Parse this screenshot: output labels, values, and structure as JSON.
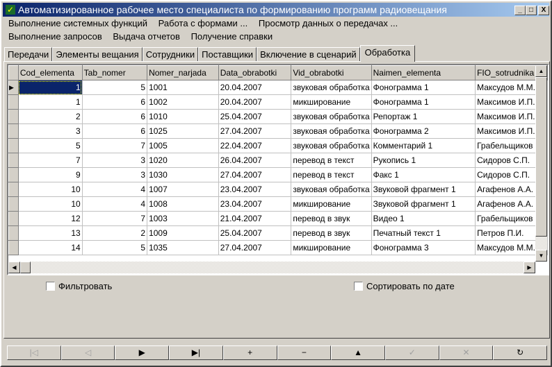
{
  "window": {
    "title": "Автоматизированное рабочее место специалиста по формированию программ радиовещания",
    "min": "_",
    "max": "□",
    "close": "X"
  },
  "menu": {
    "row1": [
      "Выполнение системных функций",
      "Работа с формами ...",
      "Просмотр данных о передачах ..."
    ],
    "row2": [
      "Выполнение запросов",
      "Выдача отчетов",
      "Получение справки"
    ]
  },
  "tabs": [
    "Передачи",
    "Элементы вещания",
    "Сотрудники",
    "Поставщики",
    "Включение в сценарий",
    "Обработка"
  ],
  "active_tab": "Обработка",
  "grid": {
    "columns": [
      "Cod_elementa",
      "Tab_nomer",
      "Nomer_narjada",
      "Data_obrabotki",
      "Vid_obrabotki",
      "Naimen_elementa",
      "FIO_sotrudnika"
    ],
    "rows": [
      [
        "1",
        "5",
        "1001",
        "20.04.2007",
        "звуковая обработка",
        "Фонограмма 1",
        "Максудов М.М."
      ],
      [
        "1",
        "6",
        "1002",
        "20.04.2007",
        "микширование",
        "Фонограмма 1",
        "Максимов И.П."
      ],
      [
        "2",
        "6",
        "1010",
        "25.04.2007",
        "звуковая обработка",
        "Репортаж 1",
        "Максимов И.П."
      ],
      [
        "3",
        "6",
        "1025",
        "27.04.2007",
        "звуковая обработка",
        "Фонограмма 2",
        "Максимов И.П."
      ],
      [
        "5",
        "7",
        "1005",
        "22.04.2007",
        "звуковая обработка",
        "Комментарий 1",
        "Грабельщиков П"
      ],
      [
        "7",
        "3",
        "1020",
        "26.04.2007",
        "перевод в текст",
        "Рукопись 1",
        "Сидоров С.П."
      ],
      [
        "9",
        "3",
        "1030",
        "27.04.2007",
        "перевод в текст",
        "Факс 1",
        "Сидоров С.П."
      ],
      [
        "10",
        "4",
        "1007",
        "23.04.2007",
        "звуковая обработка",
        "Звуковой фрагмент 1",
        "Агафенов А.А."
      ],
      [
        "10",
        "4",
        "1008",
        "23.04.2007",
        "микширование",
        "Звуковой фрагмент 1",
        "Агафенов А.А."
      ],
      [
        "12",
        "7",
        "1003",
        "21.04.2007",
        "перевод в звук",
        "Видео 1",
        "Грабельщиков П"
      ],
      [
        "13",
        "2",
        "1009",
        "25.04.2007",
        "перевод в звук",
        "Печатный текст 1",
        "Петров П.И."
      ],
      [
        "14",
        "5",
        "1035",
        "27.04.2007",
        "микширование",
        "Фонограмма 3",
        "Максудов М.М."
      ]
    ]
  },
  "checkboxes": {
    "filter": "Фильтровать",
    "sort_by_date": "Сортировать по дате"
  },
  "navigator": [
    {
      "name": "first",
      "glyph": "|◁",
      "enabled": false
    },
    {
      "name": "prior",
      "glyph": "◁",
      "enabled": false
    },
    {
      "name": "next",
      "glyph": "▶",
      "enabled": true
    },
    {
      "name": "last",
      "glyph": "▶|",
      "enabled": true
    },
    {
      "name": "insert",
      "glyph": "+",
      "enabled": true
    },
    {
      "name": "delete",
      "glyph": "−",
      "enabled": true
    },
    {
      "name": "edit",
      "glyph": "▲",
      "enabled": true
    },
    {
      "name": "post",
      "glyph": "✓",
      "enabled": false
    },
    {
      "name": "cancel",
      "glyph": "✕",
      "enabled": false
    },
    {
      "name": "refresh",
      "glyph": "↻",
      "enabled": true
    }
  ]
}
